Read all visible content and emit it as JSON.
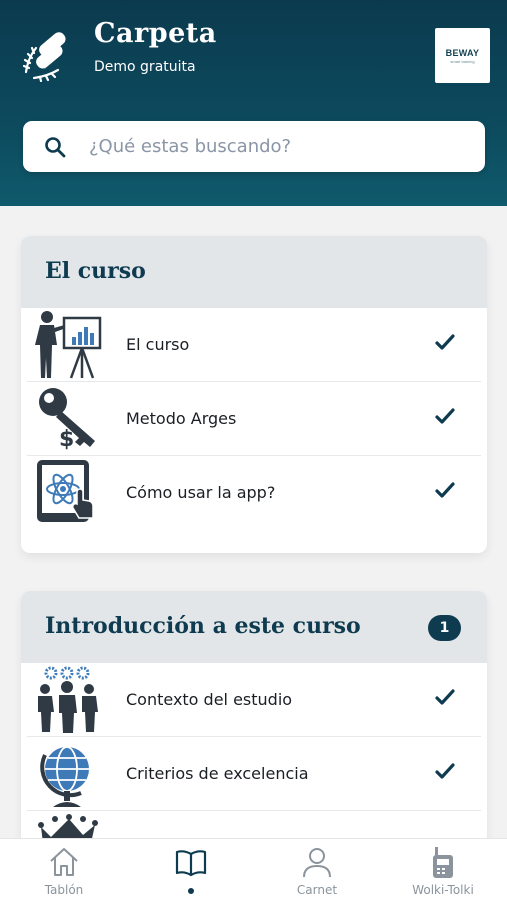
{
  "header": {
    "title": "Carpeta",
    "subtitle": "Demo gratuita",
    "logo_icon": "diploma-laurel-icon",
    "brand": {
      "name": "BEWAY",
      "tagline": "smart training"
    }
  },
  "search": {
    "placeholder": "¿Qué estas buscando?",
    "value": ""
  },
  "sections": [
    {
      "title": "El curso",
      "badge": null,
      "items": [
        {
          "label": "El curso",
          "icon": "presenter-chart-icon",
          "done": true
        },
        {
          "label": "Metodo Arges",
          "icon": "dollar-key-icon",
          "done": true
        },
        {
          "label": "Cómo usar la app?",
          "icon": "tablet-atom-icon",
          "done": true
        }
      ]
    },
    {
      "title": "Introducción a este curso",
      "badge": "1",
      "items": [
        {
          "label": "Contexto del estudio",
          "icon": "team-gears-icon",
          "done": true
        },
        {
          "label": "Criterios de excelencia",
          "icon": "globe-icon",
          "done": true
        }
      ]
    }
  ],
  "tabbar": {
    "tabs": [
      {
        "label": "Tablón",
        "icon": "home-icon",
        "active": false
      },
      {
        "label": "",
        "icon": "book-icon",
        "active": true
      },
      {
        "label": "Carnet",
        "icon": "user-icon",
        "active": false
      },
      {
        "label": "Wolki-Tolki",
        "icon": "walkie-talkie-icon",
        "active": false
      }
    ]
  },
  "colors": {
    "primary": "#0e3b4f",
    "header_gradient_end": "#0f5a6c",
    "section_header_bg": "#e3e6e9"
  }
}
